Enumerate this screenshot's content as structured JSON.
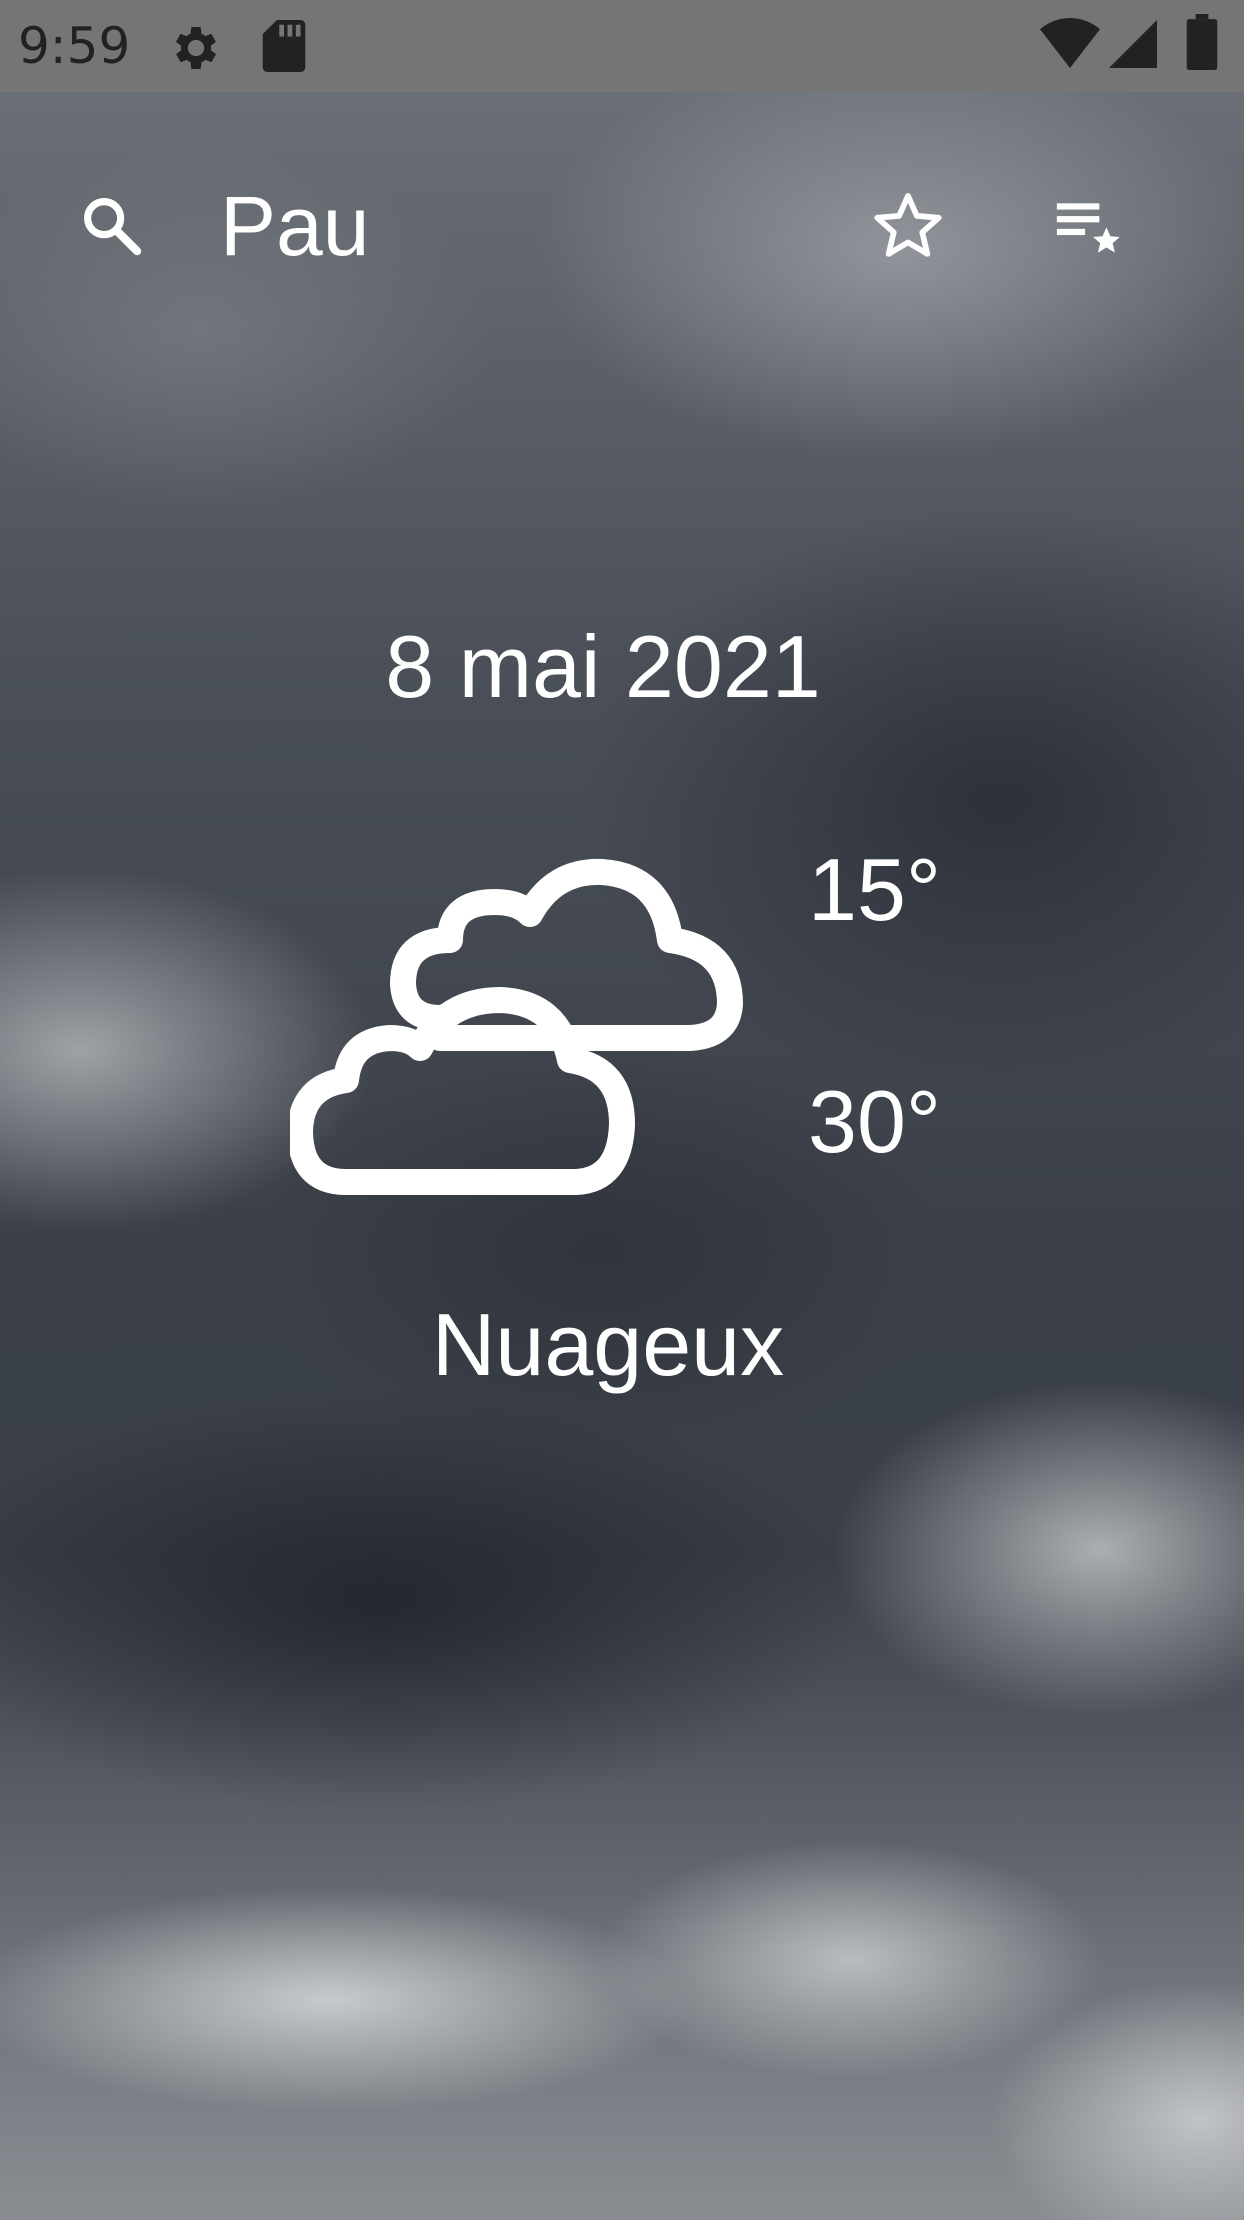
{
  "status_bar": {
    "time": "9:59",
    "icons": [
      "gear-icon",
      "sd-card-icon",
      "wifi-icon",
      "signal-icon",
      "battery-icon"
    ]
  },
  "toolbar": {
    "city": "Pau",
    "icons": [
      "search-icon",
      "star-outline-icon",
      "favorites-list-icon"
    ]
  },
  "weather": {
    "date": "8 mai 2021",
    "temp_min": "15°",
    "temp_max": "30°",
    "condition": "Nuageux",
    "icon": "clouds-icon"
  },
  "colors": {
    "text": "#ffffff",
    "status_bar": "#757575"
  }
}
